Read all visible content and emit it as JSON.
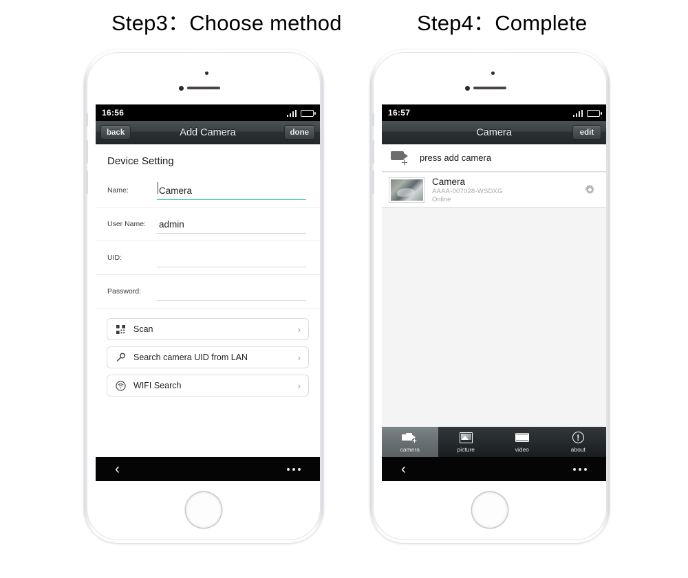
{
  "steps": {
    "step3": "Step3：Choose method",
    "step4": "Step4：Complete"
  },
  "phone_left": {
    "status": {
      "time": "16:56"
    },
    "navbar": {
      "back": "back",
      "title": "Add Camera",
      "done": "done"
    },
    "form": {
      "section_title": "Device Setting",
      "rows": [
        {
          "label": "Name:",
          "value": "Camera",
          "placeholder": "",
          "focused": true
        },
        {
          "label": "User Name:",
          "value": "admin",
          "placeholder": "",
          "focused": false
        },
        {
          "label": "UID:",
          "value": "",
          "placeholder": "",
          "focused": false
        },
        {
          "label": "Password:",
          "value": "",
          "placeholder": "",
          "focused": false
        }
      ]
    },
    "methods": [
      {
        "icon": "qr-scan-icon",
        "label": "Scan",
        "chevron": "›"
      },
      {
        "icon": "magnifier-icon",
        "label": "Search camera UID from LAN",
        "chevron": "›"
      },
      {
        "icon": "wifi-circle-icon",
        "label": "WIFI Search",
        "chevron": "›"
      }
    ],
    "systembar": {
      "back": "‹",
      "menu": "···"
    }
  },
  "phone_right": {
    "status": {
      "time": "16:57"
    },
    "navbar": {
      "title": "Camera",
      "edit": "edit"
    },
    "add_row": {
      "label": "press add camera",
      "icon": "camera-plus-icon"
    },
    "camera": {
      "name": "Camera",
      "uid": "AAAA-007028-WSDXG",
      "status": "Online",
      "settings_icon": "gear-icon"
    },
    "tabs": [
      {
        "label": "camera",
        "icon": "camera-icon",
        "active": true
      },
      {
        "label": "picture",
        "icon": "picture-icon",
        "active": false
      },
      {
        "label": "video",
        "icon": "video-icon",
        "active": false
      },
      {
        "label": "about",
        "icon": "info-icon",
        "active": false
      }
    ],
    "systembar": {
      "back": "‹",
      "menu": "···"
    }
  },
  "colors": {
    "accent": "#3fb8c4",
    "navbar_dark": "#2b3031",
    "status_black": "#000000",
    "screen_bg": "#f4f4f4"
  }
}
